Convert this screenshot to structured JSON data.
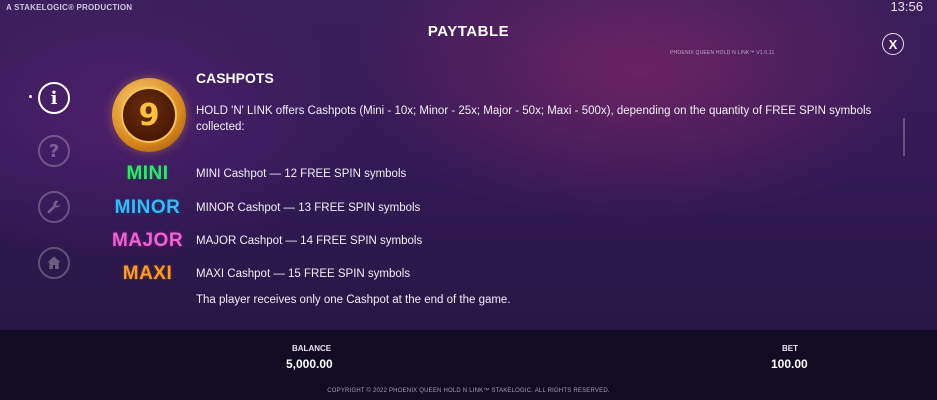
{
  "header": {
    "production": "A STAKELOGIC® PRODUCTION",
    "clock": "13:56",
    "title": "PAYTABLE",
    "version": "PHOENIX QUEEN HOLD N LINK™ V1.0.11",
    "close_symbol": "X"
  },
  "sidebar": {
    "items": [
      {
        "name": "info",
        "glyph": "i",
        "active": true
      },
      {
        "name": "help",
        "glyph": "?",
        "active": false
      },
      {
        "name": "settings",
        "glyph": "wrench",
        "active": false
      },
      {
        "name": "home",
        "glyph": "house",
        "active": false
      }
    ]
  },
  "content": {
    "coin_number": "9",
    "section_title": "CASHPOTS",
    "intro": "HOLD 'N' LINK offers Cashpots (Mini - 10x; Minor - 25x; Major - 50x; Maxi - 500x), depending on the quantity of FREE SPIN symbols collected:",
    "cashpots": [
      {
        "label": "MINI",
        "text": "MINI Cashpot — 12 FREE SPIN symbols",
        "color": "#39e07a"
      },
      {
        "label": "MINOR",
        "text": "MINOR Cashpot — 13 FREE SPIN symbols",
        "color": "#3fb6f5"
      },
      {
        "label": "MAJOR",
        "text": "MAJOR Cashpot — 14 FREE SPIN symbols",
        "color": "#e866d6"
      },
      {
        "label": "MAXI",
        "text": "MAXI Cashpot — 15 FREE SPIN symbols",
        "color": "#f59b3a"
      }
    ],
    "note": "Tha player receives only one Cashpot at the end of the game."
  },
  "footer": {
    "balance_label": "BALANCE",
    "balance_value": "5,000.00",
    "bet_label": "BET",
    "bet_value": "100.00",
    "copyright": "COPYRIGHT © 2022 PHOENIX QUEEN HOLD N LINK™ STAKELOGIC. ALL RIGHTS RESERVED."
  }
}
